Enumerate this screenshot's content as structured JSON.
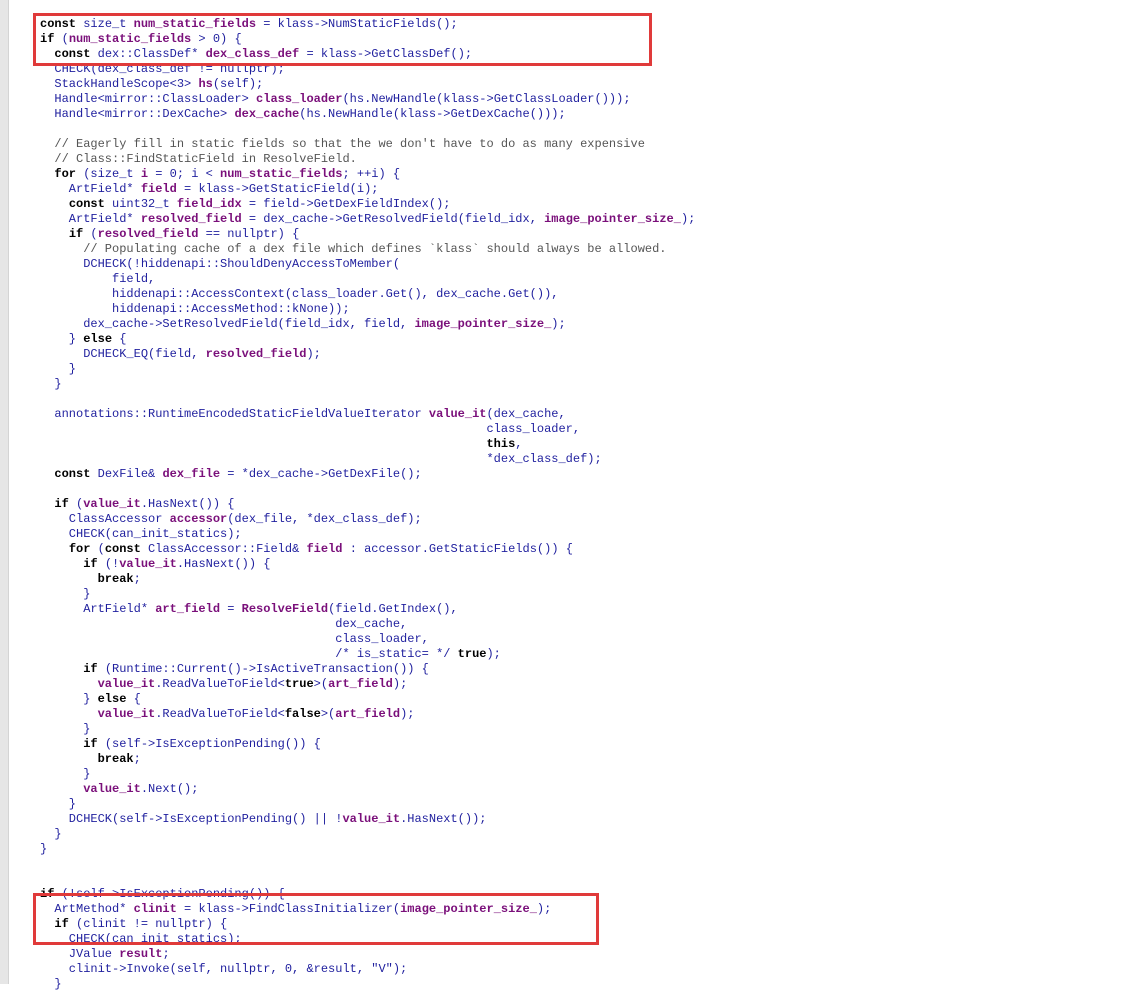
{
  "code_lines": [
    [
      [
        "kw",
        "const"
      ],
      [
        "t",
        " size_t "
      ],
      [
        "vr",
        "num_static_fields"
      ],
      [
        "t",
        " = klass->NumStaticFields();"
      ]
    ],
    [
      [
        "kw",
        "if"
      ],
      [
        "t",
        " ("
      ],
      [
        "vr",
        "num_static_fields"
      ],
      [
        "t",
        " > 0) {"
      ]
    ],
    [
      [
        "t",
        "  "
      ],
      [
        "kw",
        "const"
      ],
      [
        "t",
        " dex::ClassDef* "
      ],
      [
        "vr",
        "dex_class_def"
      ],
      [
        "t",
        " = klass->GetClassDef();"
      ]
    ],
    [
      [
        "t",
        "  CHECK(dex_class_def != nullptr);"
      ]
    ],
    [
      [
        "t",
        "  StackHandleScope<3> "
      ],
      [
        "vr",
        "hs"
      ],
      [
        "t",
        "(self);"
      ]
    ],
    [
      [
        "t",
        "  Handle<mirror::ClassLoader> "
      ],
      [
        "vr",
        "class_loader"
      ],
      [
        "t",
        "(hs.NewHandle(klass->GetClassLoader()));"
      ]
    ],
    [
      [
        "t",
        "  Handle<mirror::DexCache> "
      ],
      [
        "vr",
        "dex_cache"
      ],
      [
        "t",
        "(hs.NewHandle(klass->GetDexCache()));"
      ]
    ],
    [
      [
        "t",
        ""
      ]
    ],
    [
      [
        "cm",
        "  // Eagerly fill in static fields so that the we don't have to do as many expensive"
      ]
    ],
    [
      [
        "cm",
        "  // Class::FindStaticField in ResolveField."
      ]
    ],
    [
      [
        "t",
        "  "
      ],
      [
        "kw",
        "for"
      ],
      [
        "t",
        " (size_t "
      ],
      [
        "vr",
        "i"
      ],
      [
        "t",
        " = 0; i < "
      ],
      [
        "vr",
        "num_static_fields"
      ],
      [
        "t",
        "; ++i) {"
      ]
    ],
    [
      [
        "t",
        "    ArtField* "
      ],
      [
        "vr",
        "field"
      ],
      [
        "t",
        " = klass->GetStaticField(i);"
      ]
    ],
    [
      [
        "t",
        "    "
      ],
      [
        "kw",
        "const"
      ],
      [
        "t",
        " uint32_t "
      ],
      [
        "vr",
        "field_idx"
      ],
      [
        "t",
        " = field->GetDexFieldIndex();"
      ]
    ],
    [
      [
        "t",
        "    ArtField* "
      ],
      [
        "vr",
        "resolved_field"
      ],
      [
        "t",
        " = dex_cache->GetResolvedField(field_idx, "
      ],
      [
        "vr",
        "image_pointer_size_"
      ],
      [
        "t",
        ");"
      ]
    ],
    [
      [
        "t",
        "    "
      ],
      [
        "kw",
        "if"
      ],
      [
        "t",
        " ("
      ],
      [
        "vr",
        "resolved_field"
      ],
      [
        "t",
        " == nullptr) {"
      ]
    ],
    [
      [
        "cm",
        "      // Populating cache of a dex file which defines `klass` should always be allowed."
      ]
    ],
    [
      [
        "t",
        "      DCHECK(!hiddenapi::ShouldDenyAccessToMember("
      ]
    ],
    [
      [
        "t",
        "          field,"
      ]
    ],
    [
      [
        "t",
        "          hiddenapi::AccessContext(class_loader.Get(), dex_cache.Get()),"
      ]
    ],
    [
      [
        "t",
        "          hiddenapi::AccessMethod::kNone));"
      ]
    ],
    [
      [
        "t",
        "      dex_cache->SetResolvedField(field_idx, field, "
      ],
      [
        "vr",
        "image_pointer_size_"
      ],
      [
        "t",
        ");"
      ]
    ],
    [
      [
        "t",
        "    } "
      ],
      [
        "kw",
        "else"
      ],
      [
        "t",
        " {"
      ]
    ],
    [
      [
        "t",
        "      DCHECK_EQ(field, "
      ],
      [
        "vr",
        "resolved_field"
      ],
      [
        "t",
        ");"
      ]
    ],
    [
      [
        "t",
        "    }"
      ]
    ],
    [
      [
        "t",
        "  }"
      ]
    ],
    [
      [
        "t",
        ""
      ]
    ],
    [
      [
        "t",
        "  annotations::RuntimeEncodedStaticFieldValueIterator "
      ],
      [
        "vr",
        "value_it"
      ],
      [
        "t",
        "(dex_cache,"
      ]
    ],
    [
      [
        "t",
        "                                                              class_loader,"
      ]
    ],
    [
      [
        "t",
        "                                                              "
      ],
      [
        "kw",
        "this"
      ],
      [
        "t",
        ","
      ]
    ],
    [
      [
        "t",
        "                                                              *dex_class_def);"
      ]
    ],
    [
      [
        "t",
        "  "
      ],
      [
        "kw",
        "const"
      ],
      [
        "t",
        " DexFile& "
      ],
      [
        "vr",
        "dex_file"
      ],
      [
        "t",
        " = *dex_cache->GetDexFile();"
      ]
    ],
    [
      [
        "t",
        ""
      ]
    ],
    [
      [
        "t",
        "  "
      ],
      [
        "kw",
        "if"
      ],
      [
        "t",
        " ("
      ],
      [
        "vr",
        "value_it"
      ],
      [
        "t",
        ".HasNext()) {"
      ]
    ],
    [
      [
        "t",
        "    ClassAccessor "
      ],
      [
        "vr",
        "accessor"
      ],
      [
        "t",
        "(dex_file, *dex_class_def);"
      ]
    ],
    [
      [
        "t",
        "    CHECK(can_init_statics);"
      ]
    ],
    [
      [
        "t",
        "    "
      ],
      [
        "kw",
        "for"
      ],
      [
        "t",
        " ("
      ],
      [
        "kw",
        "const"
      ],
      [
        "t",
        " ClassAccessor::Field& "
      ],
      [
        "vr",
        "field"
      ],
      [
        "t",
        " : accessor.GetStaticFields()) {"
      ]
    ],
    [
      [
        "t",
        "      "
      ],
      [
        "kw",
        "if"
      ],
      [
        "t",
        " (!"
      ],
      [
        "vr",
        "value_it"
      ],
      [
        "t",
        ".HasNext()) {"
      ]
    ],
    [
      [
        "t",
        "        "
      ],
      [
        "kw",
        "break"
      ],
      [
        "t",
        ";"
      ]
    ],
    [
      [
        "t",
        "      }"
      ]
    ],
    [
      [
        "t",
        "      ArtField* "
      ],
      [
        "vr",
        "art_field"
      ],
      [
        "t",
        " = "
      ],
      [
        "vr",
        "ResolveField"
      ],
      [
        "t",
        "(field.GetIndex(),"
      ]
    ],
    [
      [
        "t",
        "                                         dex_cache,"
      ]
    ],
    [
      [
        "t",
        "                                         class_loader,"
      ]
    ],
    [
      [
        "t",
        "                                         /* is_static= */ "
      ],
      [
        "kw",
        "true"
      ],
      [
        "t",
        ");"
      ]
    ],
    [
      [
        "t",
        "      "
      ],
      [
        "kw",
        "if"
      ],
      [
        "t",
        " (Runtime::Current()->IsActiveTransaction()) {"
      ]
    ],
    [
      [
        "t",
        "        "
      ],
      [
        "vr",
        "value_it"
      ],
      [
        "t",
        ".ReadValueToField<"
      ],
      [
        "kw",
        "true"
      ],
      [
        "t",
        ">("
      ],
      [
        "vr",
        "art_field"
      ],
      [
        "t",
        ");"
      ]
    ],
    [
      [
        "t",
        "      } "
      ],
      [
        "kw",
        "else"
      ],
      [
        "t",
        " {"
      ]
    ],
    [
      [
        "t",
        "        "
      ],
      [
        "vr",
        "value_it"
      ],
      [
        "t",
        ".ReadValueToField<"
      ],
      [
        "kw",
        "false"
      ],
      [
        "t",
        ">("
      ],
      [
        "vr",
        "art_field"
      ],
      [
        "t",
        ");"
      ]
    ],
    [
      [
        "t",
        "      }"
      ]
    ],
    [
      [
        "t",
        "      "
      ],
      [
        "kw",
        "if"
      ],
      [
        "t",
        " (self->IsExceptionPending()) {"
      ]
    ],
    [
      [
        "t",
        "        "
      ],
      [
        "kw",
        "break"
      ],
      [
        "t",
        ";"
      ]
    ],
    [
      [
        "t",
        "      }"
      ]
    ],
    [
      [
        "t",
        "      "
      ],
      [
        "vr",
        "value_it"
      ],
      [
        "t",
        ".Next();"
      ]
    ],
    [
      [
        "t",
        "    }"
      ]
    ],
    [
      [
        "t",
        "    DCHECK(self->IsExceptionPending() || !"
      ],
      [
        "vr",
        "value_it"
      ],
      [
        "t",
        ".HasNext());"
      ]
    ],
    [
      [
        "t",
        "  }"
      ]
    ],
    [
      [
        "t",
        "}"
      ]
    ],
    [
      [
        "t",
        ""
      ]
    ],
    [
      [
        "t",
        ""
      ]
    ],
    [
      [
        "kw",
        "if"
      ],
      [
        "t",
        " (!self->IsExceptionPending()) {"
      ]
    ],
    [
      [
        "t",
        "  ArtMethod* "
      ],
      [
        "vr",
        "clinit"
      ],
      [
        "t",
        " = klass->FindClassInitializer("
      ],
      [
        "vr",
        "image_pointer_size_"
      ],
      [
        "t",
        ");"
      ]
    ],
    [
      [
        "t",
        "  "
      ],
      [
        "kw",
        "if"
      ],
      [
        "t",
        " (clinit != nullptr) {"
      ]
    ],
    [
      [
        "t",
        "    CHECK(can_init_statics);"
      ]
    ],
    [
      [
        "t",
        "    JValue "
      ],
      [
        "vr",
        "result"
      ],
      [
        "t",
        ";"
      ]
    ],
    [
      [
        "t",
        "    clinit->Invoke(self, nullptr, 0, &result, \"V\");"
      ]
    ],
    [
      [
        "t",
        "  }"
      ]
    ]
  ],
  "highlight_color": "#e03a3a",
  "colors": {
    "keyword": "#000000",
    "variable": "#7a0f7a",
    "comment": "#555555",
    "code": "#1f1f9e"
  }
}
